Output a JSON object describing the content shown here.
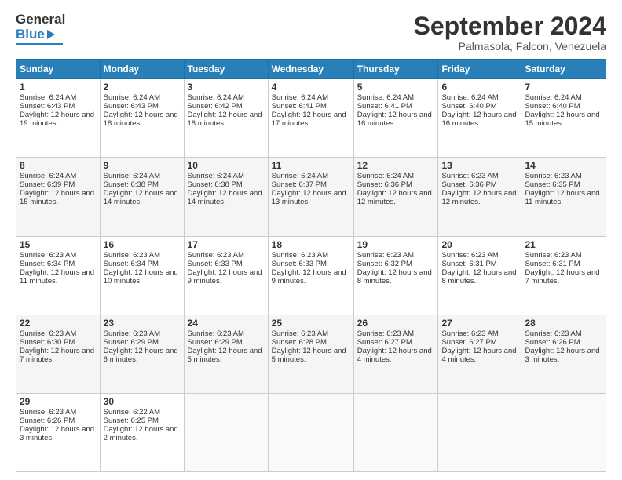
{
  "logo": {
    "line1": "General",
    "line2": "Blue"
  },
  "title": "September 2024",
  "location": "Palmasola, Falcon, Venezuela",
  "headers": [
    "Sunday",
    "Monday",
    "Tuesday",
    "Wednesday",
    "Thursday",
    "Friday",
    "Saturday"
  ],
  "weeks": [
    [
      {
        "day": "1",
        "sunrise": "6:24 AM",
        "sunset": "6:43 PM",
        "daylight": "12 hours and 19 minutes."
      },
      {
        "day": "2",
        "sunrise": "6:24 AM",
        "sunset": "6:43 PM",
        "daylight": "12 hours and 18 minutes."
      },
      {
        "day": "3",
        "sunrise": "6:24 AM",
        "sunset": "6:42 PM",
        "daylight": "12 hours and 18 minutes."
      },
      {
        "day": "4",
        "sunrise": "6:24 AM",
        "sunset": "6:41 PM",
        "daylight": "12 hours and 17 minutes."
      },
      {
        "day": "5",
        "sunrise": "6:24 AM",
        "sunset": "6:41 PM",
        "daylight": "12 hours and 16 minutes."
      },
      {
        "day": "6",
        "sunrise": "6:24 AM",
        "sunset": "6:40 PM",
        "daylight": "12 hours and 16 minutes."
      },
      {
        "day": "7",
        "sunrise": "6:24 AM",
        "sunset": "6:40 PM",
        "daylight": "12 hours and 15 minutes."
      }
    ],
    [
      {
        "day": "8",
        "sunrise": "6:24 AM",
        "sunset": "6:39 PM",
        "daylight": "12 hours and 15 minutes."
      },
      {
        "day": "9",
        "sunrise": "6:24 AM",
        "sunset": "6:38 PM",
        "daylight": "12 hours and 14 minutes."
      },
      {
        "day": "10",
        "sunrise": "6:24 AM",
        "sunset": "6:38 PM",
        "daylight": "12 hours and 14 minutes."
      },
      {
        "day": "11",
        "sunrise": "6:24 AM",
        "sunset": "6:37 PM",
        "daylight": "12 hours and 13 minutes."
      },
      {
        "day": "12",
        "sunrise": "6:24 AM",
        "sunset": "6:36 PM",
        "daylight": "12 hours and 12 minutes."
      },
      {
        "day": "13",
        "sunrise": "6:23 AM",
        "sunset": "6:36 PM",
        "daylight": "12 hours and 12 minutes."
      },
      {
        "day": "14",
        "sunrise": "6:23 AM",
        "sunset": "6:35 PM",
        "daylight": "12 hours and 11 minutes."
      }
    ],
    [
      {
        "day": "15",
        "sunrise": "6:23 AM",
        "sunset": "6:34 PM",
        "daylight": "12 hours and 11 minutes."
      },
      {
        "day": "16",
        "sunrise": "6:23 AM",
        "sunset": "6:34 PM",
        "daylight": "12 hours and 10 minutes."
      },
      {
        "day": "17",
        "sunrise": "6:23 AM",
        "sunset": "6:33 PM",
        "daylight": "12 hours and 9 minutes."
      },
      {
        "day": "18",
        "sunrise": "6:23 AM",
        "sunset": "6:33 PM",
        "daylight": "12 hours and 9 minutes."
      },
      {
        "day": "19",
        "sunrise": "6:23 AM",
        "sunset": "6:32 PM",
        "daylight": "12 hours and 8 minutes."
      },
      {
        "day": "20",
        "sunrise": "6:23 AM",
        "sunset": "6:31 PM",
        "daylight": "12 hours and 8 minutes."
      },
      {
        "day": "21",
        "sunrise": "6:23 AM",
        "sunset": "6:31 PM",
        "daylight": "12 hours and 7 minutes."
      }
    ],
    [
      {
        "day": "22",
        "sunrise": "6:23 AM",
        "sunset": "6:30 PM",
        "daylight": "12 hours and 7 minutes."
      },
      {
        "day": "23",
        "sunrise": "6:23 AM",
        "sunset": "6:29 PM",
        "daylight": "12 hours and 6 minutes."
      },
      {
        "day": "24",
        "sunrise": "6:23 AM",
        "sunset": "6:29 PM",
        "daylight": "12 hours and 5 minutes."
      },
      {
        "day": "25",
        "sunrise": "6:23 AM",
        "sunset": "6:28 PM",
        "daylight": "12 hours and 5 minutes."
      },
      {
        "day": "26",
        "sunrise": "6:23 AM",
        "sunset": "6:27 PM",
        "daylight": "12 hours and 4 minutes."
      },
      {
        "day": "27",
        "sunrise": "6:23 AM",
        "sunset": "6:27 PM",
        "daylight": "12 hours and 4 minutes."
      },
      {
        "day": "28",
        "sunrise": "6:23 AM",
        "sunset": "6:26 PM",
        "daylight": "12 hours and 3 minutes."
      }
    ],
    [
      {
        "day": "29",
        "sunrise": "6:23 AM",
        "sunset": "6:26 PM",
        "daylight": "12 hours and 3 minutes."
      },
      {
        "day": "30",
        "sunrise": "6:22 AM",
        "sunset": "6:25 PM",
        "daylight": "12 hours and 2 minutes."
      },
      null,
      null,
      null,
      null,
      null
    ]
  ]
}
